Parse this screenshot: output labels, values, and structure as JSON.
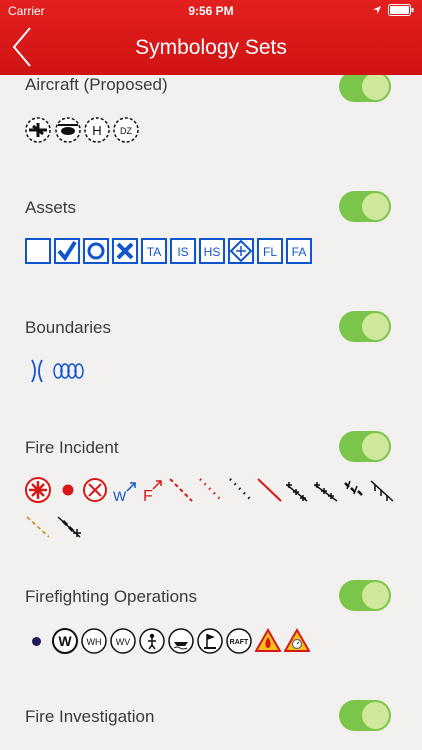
{
  "status_bar": {
    "carrier": "Carrier",
    "time": "9:56 PM"
  },
  "nav": {
    "title": "Symbology Sets"
  },
  "sections": [
    {
      "label": "Aircraft (Proposed)",
      "toggle": "on"
    },
    {
      "label": "Assets",
      "toggle": "on"
    },
    {
      "label": "Boundaries",
      "toggle": "on"
    },
    {
      "label": "Fire Incident",
      "toggle": "on"
    },
    {
      "label": "Firefighting Operations",
      "toggle": "on"
    },
    {
      "label": "Fire Investigation",
      "toggle": "on"
    }
  ],
  "symbols": {
    "aircraft": [
      "airplane-icon",
      "helicopter-icon",
      "H",
      "DZ"
    ],
    "assets": [
      "checkbox",
      "check",
      "circle",
      "x",
      "TA",
      "IS",
      "HS",
      "hazmat-icon",
      "FL",
      "FA"
    ],
    "boundaries": [
      "hourglass-line-icon",
      "loop-coil-icon"
    ],
    "fire_incident": [
      "origin-icon",
      "spot-icon",
      "circle-x-icon",
      "W",
      "F"
    ],
    "firefighting_operations": [
      "dot",
      "W",
      "WH",
      "WV",
      "person-icon",
      "boat-icon",
      "flag-icon",
      "RAFT",
      "fire-warning-icon",
      "gauge-warning-icon"
    ]
  },
  "colors": {
    "header": "#d81818",
    "toggle_on": "#7bc54a",
    "asset_blue": "#1155cc",
    "incident_red": "#d81818"
  }
}
